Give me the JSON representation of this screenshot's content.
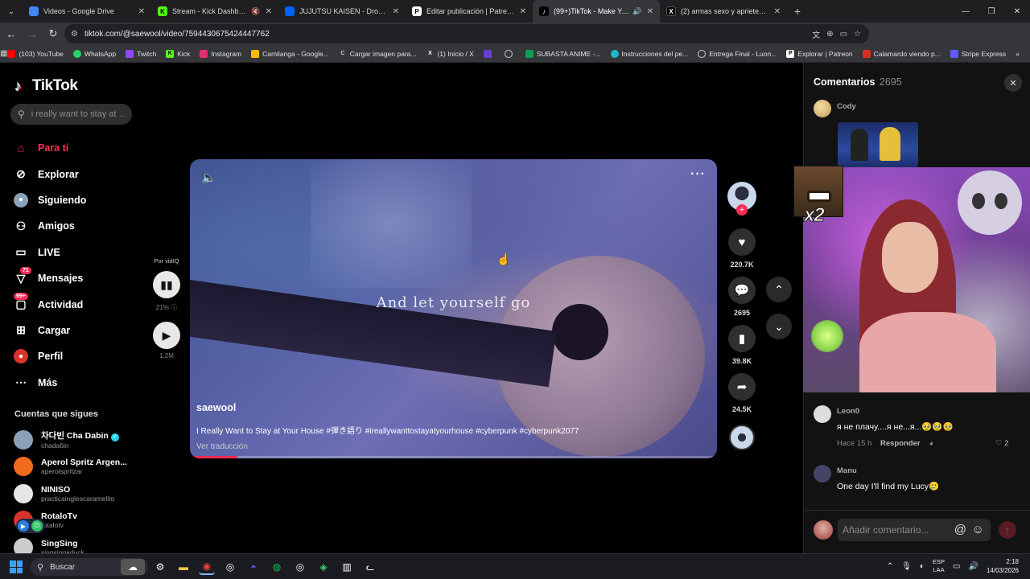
{
  "browser": {
    "tabs": [
      {
        "title": "Videos - Google Drive",
        "favicon_color": "#4285f4",
        "active": false
      },
      {
        "title": "Stream - Kick Dashboard",
        "favicon_color": "#53fc18",
        "active": false,
        "muted": true
      },
      {
        "title": "JUJUTSU KAISEN - Dropbox",
        "favicon_color": "#0061fe",
        "active": false
      },
      {
        "title": "Editar publicación | Patreon",
        "favicon_color": "#ffffff",
        "active": false
      },
      {
        "title": "(99+)TikTok - Make Your Da",
        "favicon_color": "#ffffff",
        "active": true,
        "sound": true
      },
      {
        "title": "(2) armas sexo y aprietes en X:",
        "favicon_color": "#ffffff",
        "active": false
      }
    ],
    "url": "tiktok.com/@saewool/video/7594430675424447762",
    "bookmarks": [
      {
        "label": "(103) YouTube",
        "color": "#ff0000"
      },
      {
        "label": "WhatsApp",
        "color": "#25d366"
      },
      {
        "label": "Twitch",
        "color": "#9146ff"
      },
      {
        "label": "Kick",
        "color": "#53fc18"
      },
      {
        "label": "Instagram",
        "color": "#e1306c"
      },
      {
        "label": "Camilanga - Google...",
        "color": "#fbbc04"
      },
      {
        "label": "Cargar imagen para...",
        "color": "#cccccc"
      },
      {
        "label": "(1) Inicio / X",
        "color": "#ffffff"
      },
      {
        "label": "",
        "color": "#6b3fd4"
      },
      {
        "label": "",
        "color": "#cccccc"
      },
      {
        "label": "SUBASTA ANIME -...",
        "color": "#0f9d58"
      },
      {
        "label": "Instrucciones del pe...",
        "color": "#1fb8cd"
      },
      {
        "label": "Entrega Final - Luon...",
        "color": "#cccccc"
      },
      {
        "label": "Explorar | Patreon",
        "color": "#ffffff"
      },
      {
        "label": "Calamardo viendo p...",
        "color": "#d93025"
      },
      {
        "label": "Stripe Express",
        "color": "#635bff"
      }
    ]
  },
  "tiktok": {
    "logo": "TikTok",
    "search_placeholder": "i really want to stay at ...",
    "nav": [
      {
        "label": "Para ti",
        "icon": "home-icon",
        "active": true
      },
      {
        "label": "Explorar",
        "icon": "compass-icon"
      },
      {
        "label": "Siguiendo",
        "icon": "following-icon"
      },
      {
        "label": "Amigos",
        "icon": "friends-icon"
      },
      {
        "label": "LIVE",
        "icon": "live-icon"
      },
      {
        "label": "Mensajes",
        "icon": "messages-icon",
        "badge": "71"
      },
      {
        "label": "Actividad",
        "icon": "activity-icon",
        "badge": "99+"
      },
      {
        "label": "Cargar",
        "icon": "upload-icon"
      },
      {
        "label": "Perfil",
        "icon": "profile-icon"
      },
      {
        "label": "Más",
        "icon": "more-icon"
      }
    ],
    "following_title": "Cuentas que sigues",
    "following": [
      {
        "name": "차다빈 Cha Dabin",
        "handle": "chadaбin",
        "verified": true,
        "color": "#8aa2b8"
      },
      {
        "name": "Aperol Spritz Argen...",
        "handle": "aperolspritzar",
        "color": "#f26b1d"
      },
      {
        "name": "NINISO",
        "handle": "practicainglescaramelito",
        "color": "#e6e6e6"
      },
      {
        "name": "RotaloTv",
        "handle": "rotalotv",
        "color": "#d9342b"
      },
      {
        "name": "SingSing",
        "handle": "singsingaduck",
        "color": "#cccccc"
      }
    ],
    "vidiq": {
      "by": "Por vidIQ",
      "pct": "21%",
      "views": "1.2M"
    },
    "video": {
      "subtitle": "And let yourself go",
      "author": "saewool",
      "description": "I Really Want to Stay at Your House #弾き語り #ireallywanttostayatyourhouse #cyberpunk #cyberpunk2077",
      "translate": "Ver traducción",
      "progress": 0.09
    },
    "actions": {
      "likes": "220.7K",
      "comments": "2695",
      "saves": "39.8K",
      "shares": "24.5K"
    },
    "comments_panel": {
      "title": "Comentarios",
      "count": "2695",
      "first_author": "Cody",
      "items": [
        {
          "author": "Leon0",
          "text": "я не плачу....я не...я...🥹🥹🥹",
          "time": "Hace 15 h",
          "reply": "Responder",
          "likes": "2",
          "color": "#dddddd"
        },
        {
          "author": "Manu",
          "text": "One day I'll find my Lucy🥲",
          "color": "#444466"
        }
      ],
      "input_placeholder": "Añadir comentario..."
    }
  },
  "overlay": {
    "multiplier": "x2"
  },
  "taskbar": {
    "search": "Buscar",
    "lang": "ESP",
    "region": "LAA",
    "time": "2:18",
    "date": "14/03/2026"
  }
}
